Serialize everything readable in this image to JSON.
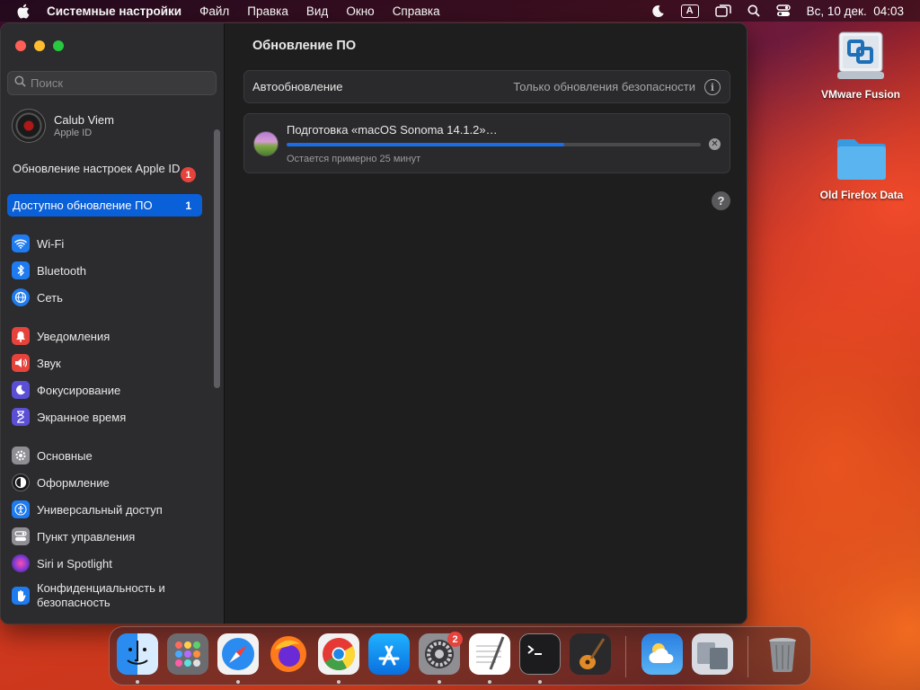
{
  "menubar": {
    "app_name": "Системные настройки",
    "items": [
      "Файл",
      "Правка",
      "Вид",
      "Окно",
      "Справка"
    ],
    "input_source": "A",
    "datetime": "Вс, 10 дек.  04:03"
  },
  "sidebar": {
    "search_placeholder": "Поиск",
    "profile": {
      "name": "Calub Viem",
      "subtitle": "Apple ID"
    },
    "notice": {
      "label": "Обновление настроек Apple ID",
      "badge": "1"
    },
    "selected": {
      "label": "Доступно обновление ПО",
      "count": "1"
    },
    "groups": [
      [
        {
          "label": "Wi-Fi",
          "icon": "wifi-icon",
          "color": "#1e7cf0"
        },
        {
          "label": "Bluetooth",
          "icon": "bluetooth-icon",
          "color": "#1e7cf0"
        },
        {
          "label": "Сеть",
          "icon": "globe-icon",
          "color": "#1e7cf0"
        }
      ],
      [
        {
          "label": "Уведомления",
          "icon": "bell-icon",
          "color": "#e5433c"
        },
        {
          "label": "Звук",
          "icon": "speaker-icon",
          "color": "#e5433c"
        },
        {
          "label": "Фокусирование",
          "icon": "moon-icon",
          "color": "#5b4fd6"
        },
        {
          "label": "Экранное время",
          "icon": "hourglass-icon",
          "color": "#5b4fd6"
        }
      ],
      [
        {
          "label": "Основные",
          "icon": "gear-icon",
          "color": "#8e8e93"
        },
        {
          "label": "Оформление",
          "icon": "appearance-icon",
          "color": "#1c1c1e"
        },
        {
          "label": "Универсальный доступ",
          "icon": "accessibility-icon",
          "color": "#1e7cf0"
        },
        {
          "label": "Пункт управления",
          "icon": "control-center-icon",
          "color": "#8e8e93"
        },
        {
          "label": "Siri и Spotlight",
          "icon": "siri-icon",
          "color": "#b83ad6"
        },
        {
          "label": "Конфиденциальность и безопасность",
          "icon": "hand-icon",
          "color": "#1e7cf0"
        }
      ]
    ]
  },
  "main": {
    "title": "Обновление ПО",
    "auto_update": {
      "label": "Автообновление",
      "value": "Только обновления безопасности"
    },
    "update": {
      "title": "Подготовка «macOS Sonoma 14.1.2»…",
      "subtitle": "Остается примерно 25 минут",
      "progress": 0.67
    },
    "help": "?"
  },
  "desktop": [
    {
      "label": "VMware Fusion",
      "icon": "vmware-fusion-icon"
    },
    {
      "label": "Old Firefox Data",
      "icon": "folder-icon"
    }
  ],
  "dock": {
    "apps": [
      {
        "name": "finder-icon",
        "running": true
      },
      {
        "name": "launchpad-icon",
        "running": false
      },
      {
        "name": "safari-icon",
        "running": true
      },
      {
        "name": "firefox-icon",
        "running": false
      },
      {
        "name": "chrome-icon",
        "running": true
      },
      {
        "name": "app-store-icon",
        "running": false
      },
      {
        "name": "system-settings-icon",
        "running": true,
        "badge": "2"
      },
      {
        "name": "textedit-icon",
        "running": true
      },
      {
        "name": "terminal-icon",
        "running": true
      },
      {
        "name": "garageband-icon",
        "running": false
      },
      {
        "name": "weather-icon",
        "running": false
      },
      {
        "name": "migration-assistant-icon",
        "running": false
      },
      {
        "name": "trash-icon",
        "running": false
      }
    ]
  }
}
